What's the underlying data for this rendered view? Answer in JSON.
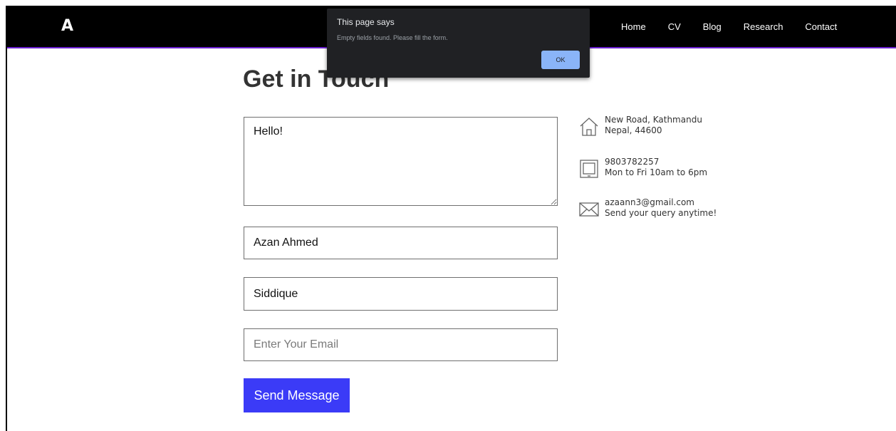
{
  "nav": {
    "logo": "A",
    "links": [
      "Home",
      "CV",
      "Blog",
      "Research",
      "Contact"
    ]
  },
  "page": {
    "title": "Get in Touch"
  },
  "form": {
    "message_value": "Hello!",
    "name_value": "Azan Ahmed",
    "surname_value": "Siddique",
    "email_value": "",
    "email_placeholder": "Enter Your Email",
    "submit_label": "Send Message"
  },
  "contact_info": [
    {
      "icon": "home-icon",
      "line1": "New Road, Kathmandu",
      "line2": "Nepal, 44600"
    },
    {
      "icon": "tablet-icon",
      "line1": "9803782257",
      "line2": "Mon to Fri 10am to 6pm"
    },
    {
      "icon": "mail-icon",
      "line1": "azaann3@gmail.com",
      "line2": "Send your query anytime!"
    }
  ],
  "dialog": {
    "title": "This page says",
    "message": "Empty fields found. Please fill the form.",
    "ok_label": "OK"
  },
  "colors": {
    "navbar": "#000000",
    "nav_underline": "#6a1fd1",
    "button": "#3b3bf7",
    "dialog_bg": "#202124",
    "dialog_ok": "#8ab4f8"
  }
}
